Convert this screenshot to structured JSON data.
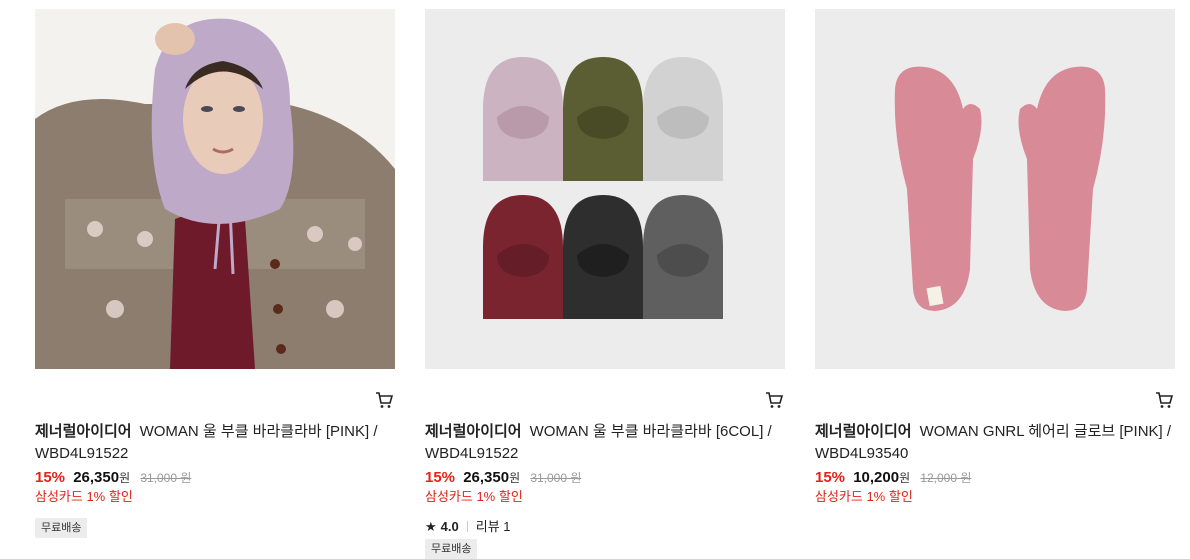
{
  "products": [
    {
      "brand": "제너럴아이디어",
      "title": "WOMAN 울 부클 바라클라바 [PINK] / WBD4L91522",
      "discount": "15%",
      "price": "26,350",
      "currency": "원",
      "original_price": "31,000 원",
      "card_promo": "삼성카드 1% 할인",
      "badge": "무료배송",
      "image_desc": "model-wearing-pink-balaclava"
    },
    {
      "brand": "제너럴아이디어",
      "title": "WOMAN 울 부클 바라클라바 [6COL] / WBD4L91522",
      "discount": "15%",
      "price": "26,350",
      "currency": "원",
      "original_price": "31,000 원",
      "card_promo": "삼성카드 1% 할인",
      "rating": "4.0",
      "review_label": "리뷰 1",
      "badge": "무료배송",
      "image_desc": "six-balaclavas-colors"
    },
    {
      "brand": "제너럴아이디어",
      "title": "WOMAN GNRL 헤어리 글로브 [PINK] / WBD4L93540",
      "discount": "15%",
      "price": "10,200",
      "currency": "원",
      "original_price": "12,000 원",
      "card_promo": "삼성카드 1% 할인",
      "image_desc": "pink-hairy-mittens"
    }
  ],
  "icons": {
    "cart": "cart-icon",
    "star": "star-icon"
  },
  "colors": {
    "discount": "#e2231a",
    "badge_bg": "#ececec"
  }
}
